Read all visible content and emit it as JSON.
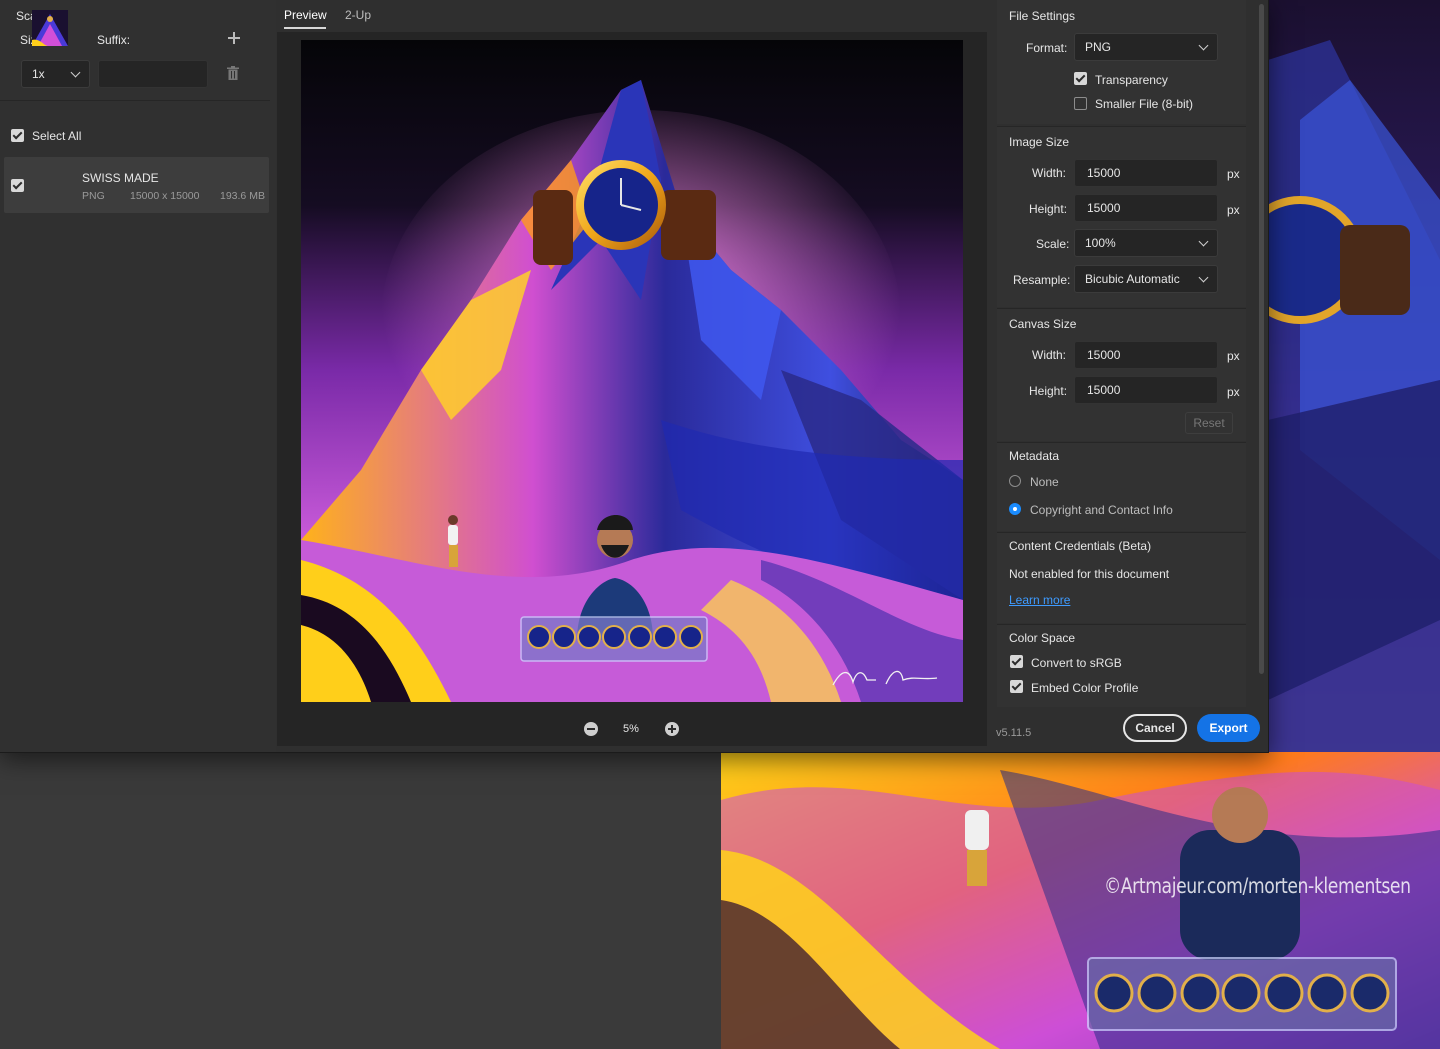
{
  "left_panel": {
    "scale_all": "Scale All",
    "size_label": "Size:",
    "suffix_label": "Suffix:",
    "size_value": "1x",
    "suffix_value": "",
    "select_all": "Select All",
    "file": {
      "name": "SWISS MADE",
      "format": "PNG",
      "dimensions": "15000 x 15000",
      "filesize": "193.6 MB"
    }
  },
  "preview": {
    "tabs": [
      "Preview",
      "2-Up"
    ],
    "active_tab": "Preview",
    "zoom": "5%",
    "signature": "Morten Klementsen"
  },
  "file_settings": {
    "title": "File Settings",
    "format_label": "Format:",
    "format_value": "PNG",
    "transparency_label": "Transparency",
    "transparency_checked": true,
    "smaller_file_label": "Smaller File (8-bit)",
    "smaller_file_checked": false
  },
  "image_size": {
    "title": "Image Size",
    "width_label": "Width:",
    "width_value": "15000",
    "height_label": "Height:",
    "height_value": "15000",
    "unit": "px",
    "scale_label": "Scale:",
    "scale_value": "100%",
    "resample_label": "Resample:",
    "resample_value": "Bicubic Automatic"
  },
  "canvas_size": {
    "title": "Canvas Size",
    "width_label": "Width:",
    "width_value": "15000",
    "height_label": "Height:",
    "height_value": "15000",
    "unit": "px",
    "reset_label": "Reset"
  },
  "metadata": {
    "title": "Metadata",
    "none_label": "None",
    "copyright_label": "Copyright and Contact Info",
    "selected": "Copyright and Contact Info"
  },
  "content_credentials": {
    "title": "Content Credentials (Beta)",
    "status": "Not enabled for this document",
    "link": "Learn more"
  },
  "color_space": {
    "title": "Color Space",
    "convert_label": "Convert to sRGB",
    "embed_label": "Embed Color Profile"
  },
  "footer": {
    "version": "v5.11.5",
    "cancel": "Cancel",
    "export": "Export"
  },
  "background": {
    "watermark": "©Artmajeur.com/morten-klementsen"
  },
  "colors": {
    "accent": "#1473e6",
    "radio_selected": "#1a8cff",
    "link": "#3e9bff",
    "dialog_bg": "#2f2f2f"
  }
}
